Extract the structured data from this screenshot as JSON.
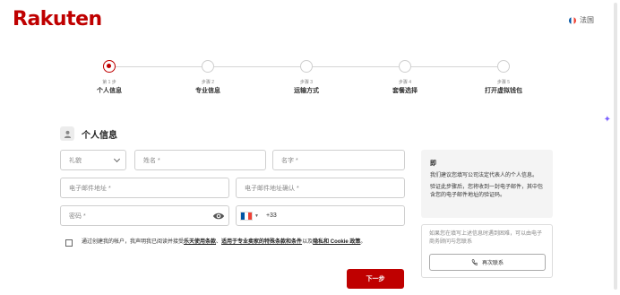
{
  "header": {
    "logo": "Rakuten",
    "language": "法国"
  },
  "stepper": {
    "steps": [
      {
        "small": "第 1 步",
        "name": "个人信息",
        "active": true
      },
      {
        "small": "步骤 2",
        "name": "专业信息",
        "active": false
      },
      {
        "small": "步骤 3",
        "name": "运输方式",
        "active": false
      },
      {
        "small": "步骤 4",
        "name": "套餐选择",
        "active": false
      },
      {
        "small": "步骤 5",
        "name": "打开虚拟钱包",
        "active": false
      }
    ]
  },
  "section": {
    "title": "个人信息"
  },
  "form": {
    "title_select": "礼貌",
    "first_name_placeholder": "姓名 *",
    "last_name_placeholder": "名字 *",
    "email_placeholder": "电子邮件地址 *",
    "email_confirm_placeholder": "电子邮件地址确认 *",
    "password_placeholder": "密码 *",
    "phone_code": "+33"
  },
  "terms": {
    "prefix": "通过创建我的帐户，我声明我已阅读并接受",
    "link1": "乐天使用条款",
    "middle": "、",
    "link2": "适用于专业卖家的特殊条款和条件",
    "joiner": "以及",
    "link3": "隐私和 Cookie 政策",
    "suffix": "。"
  },
  "buttons": {
    "next": "下一步",
    "contact_again": "再次联系"
  },
  "info": {
    "title": "即",
    "p1": "我们建议您填写公司法定代表人的个人信息。",
    "p2": "验证此步骤后，您将收到一封电子邮件，其中包含您的电子邮件地址的验证码。"
  },
  "contact": {
    "text": "如果您在填写上述信息时遇到困难，可以由电子商务顾问与您联系"
  },
  "colors": {
    "brand": "#bf0000"
  },
  "icons": {
    "eye": "eye-icon",
    "user": "user-icon",
    "phone": "phone-icon",
    "sparkle": "sparkle-icon"
  }
}
